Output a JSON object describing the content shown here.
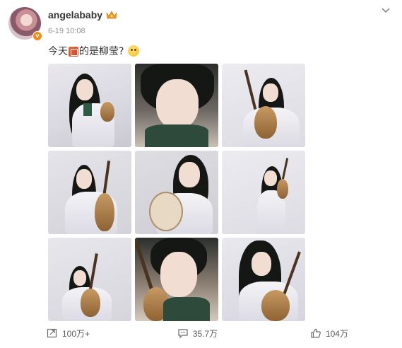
{
  "post": {
    "username": "angelababy",
    "verified_badge": "v",
    "timestamp": "6-19 10:08",
    "text_before": "今天",
    "text_after": "的是柳莹?",
    "emoji_inline": "inline-sticker-icon",
    "emoji_end": "smile-emoji-icon"
  },
  "photos": [
    {
      "name": "photo-1"
    },
    {
      "name": "photo-2"
    },
    {
      "name": "photo-3"
    },
    {
      "name": "photo-4"
    },
    {
      "name": "photo-5"
    },
    {
      "name": "photo-6"
    },
    {
      "name": "photo-7"
    },
    {
      "name": "photo-8"
    },
    {
      "name": "photo-9"
    }
  ],
  "actions": {
    "share_count": "100万+",
    "comment_count": "35.7万",
    "like_count": "104万"
  },
  "colors": {
    "username": "#333333",
    "meta": "#939393",
    "badge": "#f08c1a",
    "crown": "#f0a020"
  }
}
